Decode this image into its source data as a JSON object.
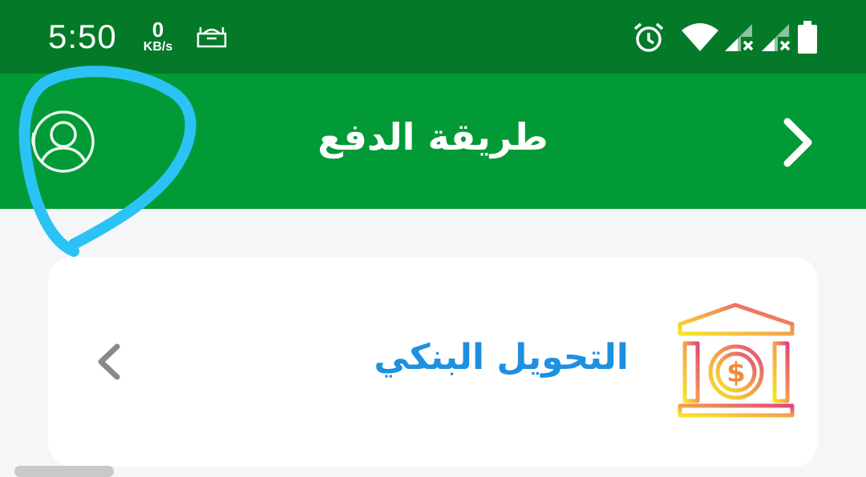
{
  "status_bar": {
    "time": "5:50",
    "net_speed_value": "0",
    "net_speed_unit": "KB/s",
    "icons": [
      "app-notification-icon",
      "alarm-icon",
      "wifi-icon",
      "signal-no-service-icon",
      "signal-no-service-icon",
      "battery-icon"
    ]
  },
  "header": {
    "title": "طريقة الدفع",
    "back_icon": "chevron-right-icon",
    "profile_icon": "user-profile-icon",
    "background": "#029a37"
  },
  "payment_methods": [
    {
      "label": "التحويل البنكي",
      "icon": "bank-dollar-icon",
      "label_color": "#1e90e0",
      "arrow_icon": "chevron-left-icon"
    }
  ],
  "annotation": {
    "type": "hand-drawn circle",
    "color": "#2bc3f5"
  }
}
